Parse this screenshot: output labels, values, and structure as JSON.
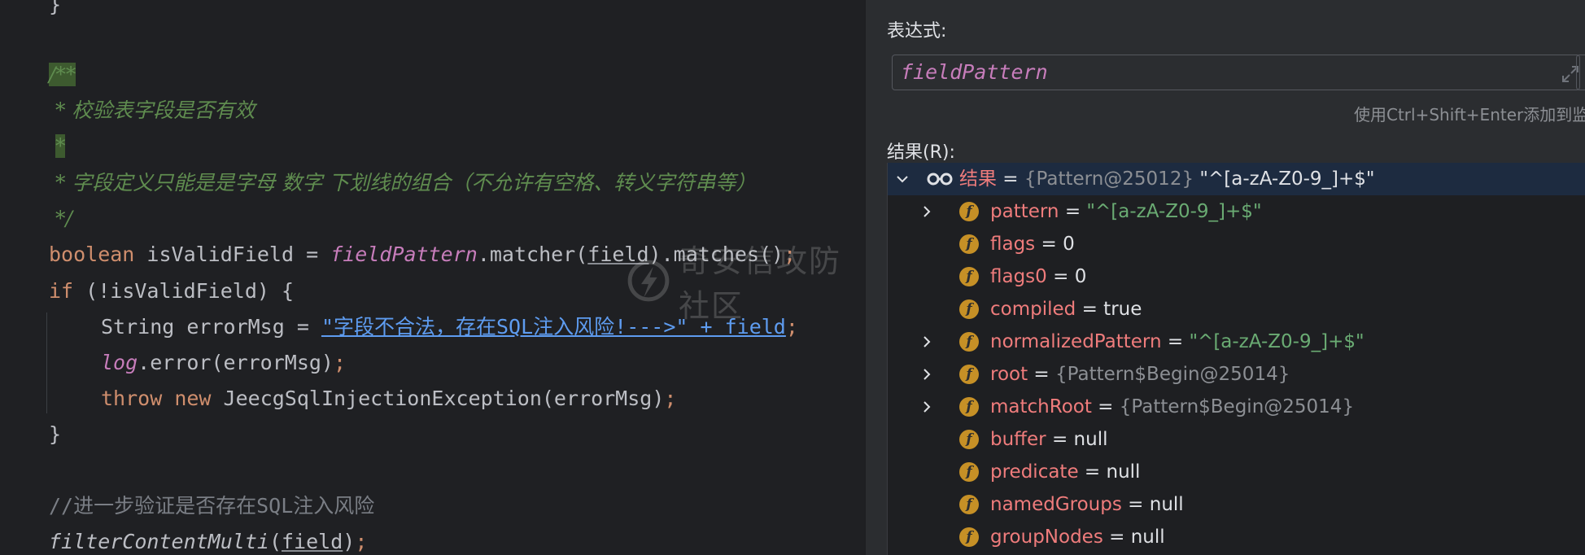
{
  "editor": {
    "lines": [
      {
        "id": "close-brace-top",
        "segments": [
          {
            "t": "}",
            "c": "plain"
          }
        ]
      },
      {
        "id": "doc-open",
        "segments": [
          {
            "t": "/**",
            "c": "doc-hl"
          }
        ]
      },
      {
        "id": "doc-line1",
        "segments": [
          {
            "t": " * 校验表字段是否有效",
            "c": "doc"
          }
        ]
      },
      {
        "id": "doc-line2",
        "segments": [
          {
            "t": " ",
            "c": "doc"
          },
          {
            "t": "*",
            "c": "doc-hl"
          }
        ]
      },
      {
        "id": "doc-line3",
        "segments": [
          {
            "t": " * 字段定义只能是是字母 数字 下划线的组合（不允许有空格、转义字符串等）",
            "c": "doc"
          }
        ]
      },
      {
        "id": "doc-close",
        "segments": [
          {
            "t": " */",
            "c": "doc"
          }
        ]
      },
      {
        "id": "boolean-line",
        "segments": [
          {
            "t": "boolean",
            "c": "kw"
          },
          {
            "t": " isValidField = ",
            "c": "plain"
          },
          {
            "t": "fieldPattern",
            "c": "fld"
          },
          {
            "t": ".matcher(",
            "c": "plain"
          },
          {
            "t": "field",
            "c": "ul"
          },
          {
            "t": ").matches()",
            "c": "plain"
          },
          {
            "t": ";",
            "c": "semi"
          }
        ]
      },
      {
        "id": "if-line",
        "segments": [
          {
            "t": "if",
            "c": "kw"
          },
          {
            "t": " (!isValidField) {",
            "c": "plain"
          }
        ]
      },
      {
        "id": "errormsg-line",
        "segments": [
          {
            "t": "String errorMsg = ",
            "c": "plain"
          },
          {
            "t": "\"字段不合法，存在SQL注入风险!--->\" + field",
            "c": "str-link"
          },
          {
            "t": ";",
            "c": "semi"
          }
        ]
      },
      {
        "id": "log-line",
        "segments": [
          {
            "t": "log",
            "c": "fld"
          },
          {
            "t": ".error(errorMsg)",
            "c": "plain"
          },
          {
            "t": ";",
            "c": "semi"
          }
        ]
      },
      {
        "id": "throw-line",
        "segments": [
          {
            "t": "throw",
            "c": "kw"
          },
          {
            "t": " ",
            "c": "plain"
          },
          {
            "t": "new",
            "c": "kw"
          },
          {
            "t": " JeecgSqlInjectionException(errorMsg)",
            "c": "plain"
          },
          {
            "t": ";",
            "c": "semi"
          }
        ]
      },
      {
        "id": "close-brace",
        "segments": [
          {
            "t": "}",
            "c": "plain"
          }
        ]
      },
      {
        "id": "empty-line",
        "segments": [
          {
            "t": "",
            "c": "plain"
          }
        ]
      },
      {
        "id": "comment-line",
        "segments": [
          {
            "t": "//进一步验证是否存在SQL注入风险",
            "c": "line-comment"
          }
        ]
      },
      {
        "id": "filter-line",
        "segments": [
          {
            "t": "filterContentMulti",
            "c": "ital"
          },
          {
            "t": "(",
            "c": "plain"
          },
          {
            "t": "field",
            "c": "ul"
          },
          {
            "t": ")",
            "c": "plain"
          },
          {
            "t": ";",
            "c": "semi"
          }
        ]
      }
    ],
    "watermark": "奇安信攻防社区"
  },
  "panel": {
    "expression_label": "表达式:",
    "expression_value": "fieldPattern",
    "hint": "使用Ctrl+Shift+Enter添加到监视",
    "result_label": "结果(R):",
    "tree": [
      {
        "id": "result-root",
        "depth": 0,
        "expand": "open",
        "icon": "watch",
        "name": "结果",
        "ref": "{Pattern@25012}",
        "value": "\"^[a-zA-Z0-9_]+$\"",
        "vtype": "plain",
        "selected": true
      },
      {
        "id": "pattern",
        "depth": 1,
        "expand": "closed",
        "icon": "f",
        "name": "pattern",
        "ref": "",
        "value": "\"^[a-zA-Z0-9_]+$\"",
        "vtype": "string"
      },
      {
        "id": "flags",
        "depth": 1,
        "expand": "none",
        "icon": "f",
        "name": "flags",
        "ref": "",
        "value": "0",
        "vtype": "plain"
      },
      {
        "id": "flags0",
        "depth": 1,
        "expand": "none",
        "icon": "f",
        "name": "flags0",
        "ref": "",
        "value": "0",
        "vtype": "plain"
      },
      {
        "id": "compiled",
        "depth": 1,
        "expand": "none",
        "icon": "f",
        "name": "compiled",
        "ref": "",
        "value": "true",
        "vtype": "plain"
      },
      {
        "id": "normalizedpattern",
        "depth": 1,
        "expand": "closed",
        "icon": "f",
        "name": "normalizedPattern",
        "ref": "",
        "value": "\"^[a-zA-Z0-9_]+$\"",
        "vtype": "string"
      },
      {
        "id": "root",
        "depth": 1,
        "expand": "closed",
        "icon": "f",
        "name": "root",
        "ref": "{Pattern$Begin@25014}",
        "value": "",
        "vtype": "plain"
      },
      {
        "id": "matchroot",
        "depth": 1,
        "expand": "closed",
        "icon": "f",
        "name": "matchRoot",
        "ref": "{Pattern$Begin@25014}",
        "value": "",
        "vtype": "plain"
      },
      {
        "id": "buffer",
        "depth": 1,
        "expand": "none",
        "icon": "f",
        "name": "buffer",
        "ref": "",
        "value": "null",
        "vtype": "plain"
      },
      {
        "id": "predicate",
        "depth": 1,
        "expand": "none",
        "icon": "f",
        "name": "predicate",
        "ref": "",
        "value": "null",
        "vtype": "plain"
      },
      {
        "id": "namedgroups",
        "depth": 1,
        "expand": "none",
        "icon": "f",
        "name": "namedGroups",
        "ref": "",
        "value": "null",
        "vtype": "plain"
      },
      {
        "id": "groupnodes",
        "depth": 1,
        "expand": "none",
        "icon": "f",
        "name": "groupNodes",
        "ref": "",
        "value": "null",
        "vtype": "plain"
      }
    ]
  }
}
